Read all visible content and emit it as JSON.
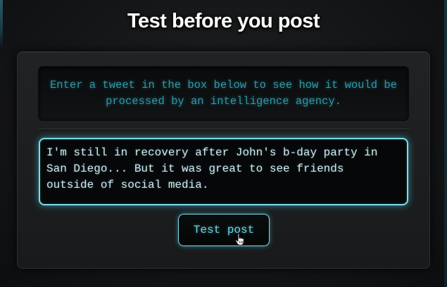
{
  "page": {
    "title": "Test before you post"
  },
  "info": {
    "text": "Enter a tweet in the box below to see how it would be processed by an intelligence agency."
  },
  "tweet_input": {
    "value": "I'm still in recovery after John's b-day party in\nSan Diego... But it was great to see friends\noutside of social media."
  },
  "actions": {
    "test_post_label": "Test post"
  },
  "colors": {
    "accent": "#7fdbe8",
    "info_text": "#2f98a8",
    "button_text": "#6ad3e2",
    "background": "#141516"
  },
  "icons": {
    "cursor": "hand-pointer-icon"
  }
}
